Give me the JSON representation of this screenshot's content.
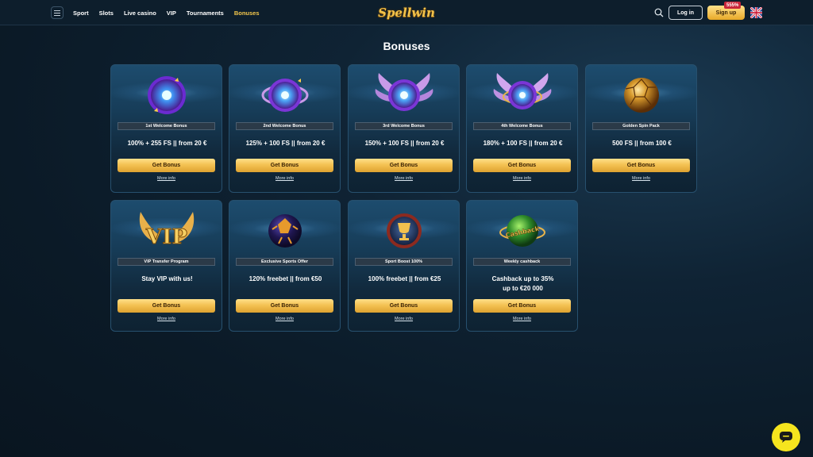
{
  "header": {
    "nav": [
      {
        "label": "Sport"
      },
      {
        "label": "Slots"
      },
      {
        "label": "Live casino"
      },
      {
        "label": "VIP"
      },
      {
        "label": "Tournaments"
      },
      {
        "label": "Bonuses",
        "active": true
      }
    ],
    "logo": "Spellwin",
    "login_label": "Log in",
    "signup_label": "Sign up",
    "promo_badge": "555%",
    "language_flag": "uk-flag-icon"
  },
  "page_title": "Bonuses",
  "bonuses": [
    {
      "name": "1st Welcome Bonus",
      "desc": "100% + 255 FS || from 20 €",
      "button": "Get Bonus",
      "more": "More info",
      "icon": "purple-orb-icon"
    },
    {
      "name": "2nd Welcome Bonus",
      "desc": "125% + 100 FS || from 20 €",
      "button": "Get Bonus",
      "more": "More info",
      "icon": "purple-orb-ring-icon"
    },
    {
      "name": "3rd Welcome Bonus",
      "desc": "150% + 100 FS || from 20 €",
      "button": "Get Bonus",
      "more": "More info",
      "icon": "winged-orb-icon"
    },
    {
      "name": "4th Welcome Bonus",
      "desc": "180% + 100 FS || from 20 €",
      "button": "Get Bonus",
      "more": "More info",
      "icon": "winged-orb-gold-icon"
    },
    {
      "name": "Golden Spin Pack",
      "desc": "500 FS || from 100 €",
      "button": "Get Bonus",
      "more": "More info",
      "icon": "golden-ball-icon"
    },
    {
      "name": "VIP Transfer Program",
      "desc": "Stay VIP with us!",
      "button": "Get Bonus",
      "more": "More info",
      "icon": "vip-wings-icon"
    },
    {
      "name": "Exclusive Sports Offer",
      "desc": "120% freebet || from €50",
      "button": "Get Bonus",
      "more": "More info",
      "icon": "sports-ball-icon"
    },
    {
      "name": "Sport Boost 100%",
      "desc": "100% freebet || from €25",
      "button": "Get Bonus",
      "more": "More info",
      "icon": "trophy-orb-icon"
    },
    {
      "name": "Weekly cashback",
      "desc": "Cashback up to 35% up to €20 000",
      "button": "Get Bonus",
      "more": "More info",
      "icon": "cashback-orb-icon"
    }
  ],
  "art_text": {
    "vip": "VIP",
    "cashback": "Cashback"
  },
  "colors": {
    "accent_gold": "#f5c84c",
    "chat_button": "#f6e51e",
    "background": "#0f2334"
  }
}
